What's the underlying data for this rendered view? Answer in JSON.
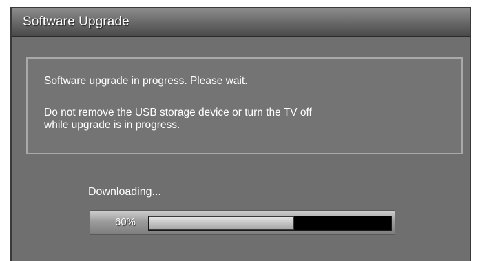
{
  "dialog": {
    "title": "Software Upgrade",
    "message_line1": "Software upgrade in progress. Please wait.",
    "message_line2": "Do not remove the USB storage device or turn the TV off",
    "message_line3": "while upgrade is in progress."
  },
  "progress": {
    "status": "Downloading...",
    "percent_label": "60%",
    "value": 0.6
  },
  "colors": {
    "panel": "#6f6f6f",
    "text": "#ffffff",
    "bar_track": "#000000"
  }
}
